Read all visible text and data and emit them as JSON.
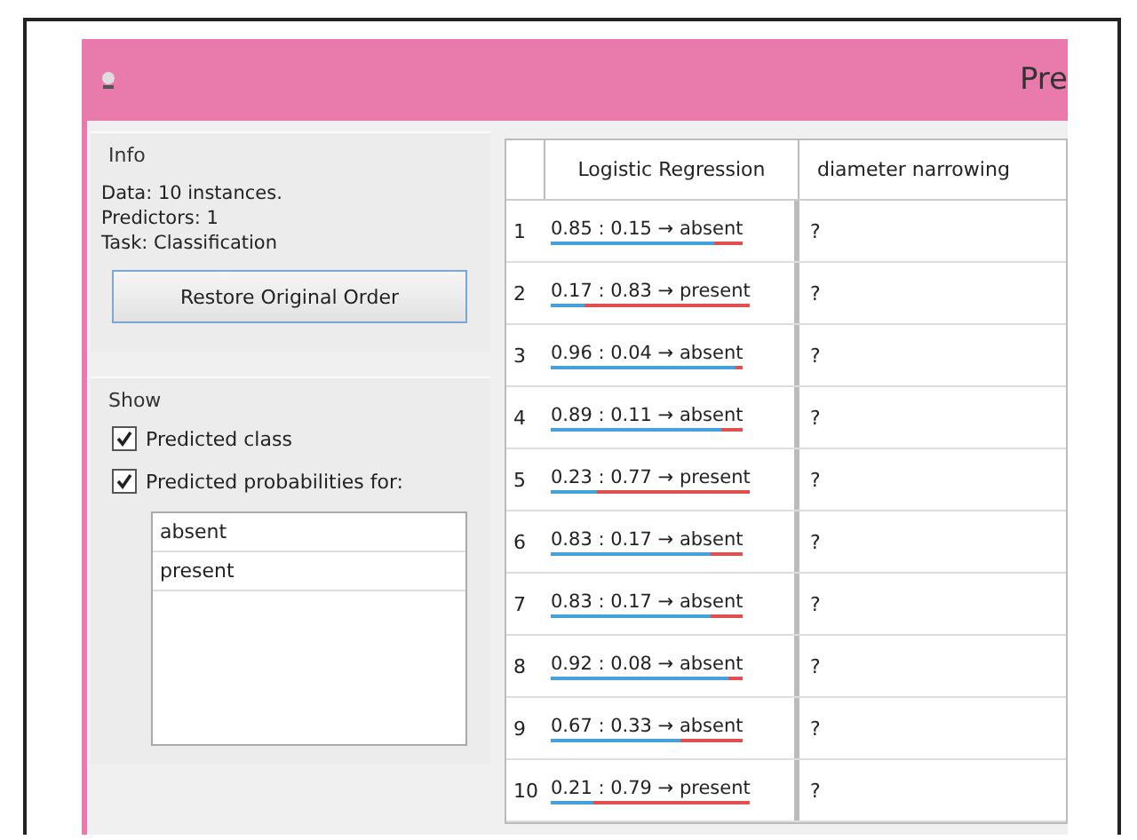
{
  "window": {
    "title": "Pre"
  },
  "info": {
    "title": "Info",
    "lines": [
      "Data: 10 instances.",
      "Predictors: 1",
      "Task: Classification"
    ],
    "button": "Restore Original Order"
  },
  "show": {
    "title": "Show",
    "options": [
      {
        "label": "Predicted class",
        "checked": true
      },
      {
        "label": "Predicted probabilities for:",
        "checked": true
      }
    ],
    "classes": [
      {
        "label": "absent",
        "selected": false
      },
      {
        "label": "present",
        "selected": false
      }
    ]
  },
  "table": {
    "columns": [
      "Logistic Regression",
      "diameter narrowing"
    ],
    "rows": [
      {
        "index": "1",
        "prediction": "0.85 : 0.15 → absent",
        "level": 0.85,
        "value": "?"
      },
      {
        "index": "2",
        "prediction": "0.17 : 0.83 → present",
        "level": 0.17,
        "value": "?"
      },
      {
        "index": "3",
        "prediction": "0.96 : 0.04 → absent",
        "level": 0.96,
        "value": "?"
      },
      {
        "index": "4",
        "prediction": "0.89 : 0.11 → absent",
        "level": 0.89,
        "value": "?"
      },
      {
        "index": "5",
        "prediction": "0.23 : 0.77 → present",
        "level": 0.23,
        "value": "?"
      },
      {
        "index": "6",
        "prediction": "0.83 : 0.17 → absent",
        "level": 0.83,
        "value": "?"
      },
      {
        "index": "7",
        "prediction": "0.83 : 0.17 → absent",
        "level": 0.83,
        "value": "?"
      },
      {
        "index": "8",
        "prediction": "0.92 : 0.08 → absent",
        "level": 0.92,
        "value": "?"
      },
      {
        "index": "9",
        "prediction": "0.67 : 0.33 → absent",
        "level": 0.67,
        "value": "?"
      },
      {
        "index": "10",
        "prediction": "0.21 : 0.79 → present",
        "level": 0.21,
        "value": "?"
      }
    ]
  }
}
